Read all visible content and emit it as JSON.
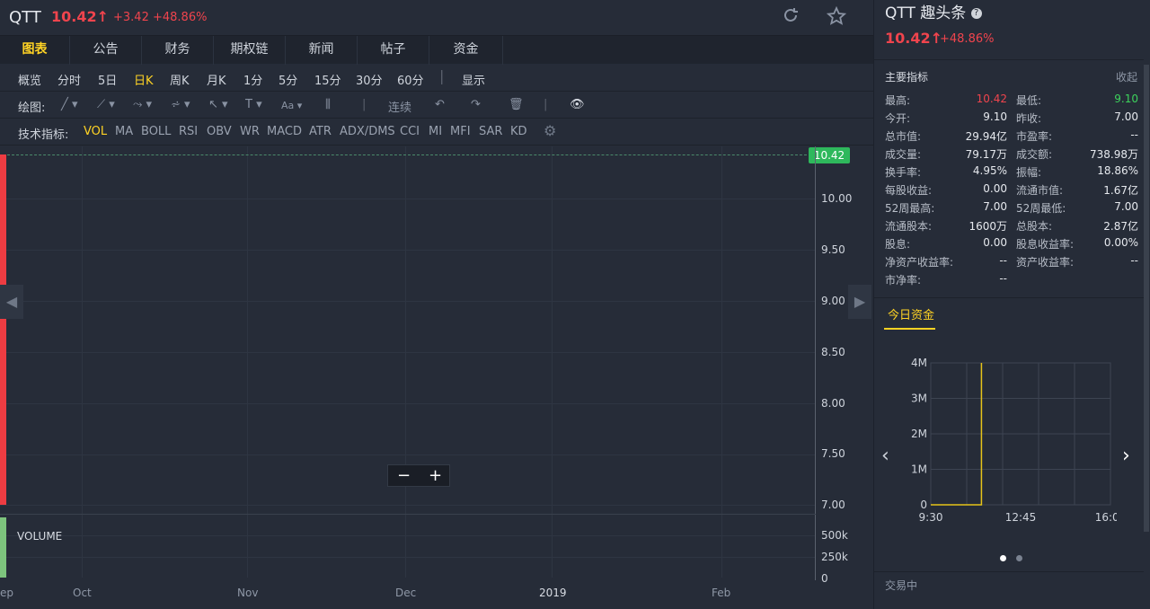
{
  "header": {
    "symbol": "QTT",
    "price": "10.42",
    "arrow": "↑",
    "change": "+3.42",
    "change_pct": "+48.86%",
    "refresh_icon": "refresh-icon",
    "star_icon": "star-icon"
  },
  "tabs": [
    "图表",
    "公告",
    "财务",
    "期权链",
    "新闻",
    "帖子",
    "资金"
  ],
  "periods": [
    "概览",
    "分时",
    "5日",
    "日K",
    "周K",
    "月K",
    "1分",
    "5分",
    "15分",
    "30分",
    "60分",
    "显示"
  ],
  "drawing_label": "绘图:",
  "draw_tools": {
    "continuous": "连续"
  },
  "indicator_label": "技术指标:",
  "indicators": [
    "VOL",
    "MA",
    "BOLL",
    "RSI",
    "OBV",
    "WR",
    "MACD",
    "ATR",
    "ADX/DMS",
    "CCI",
    "MI",
    "MFI",
    "SAR",
    "KD"
  ],
  "chart": {
    "last_price_tag": "10.42",
    "y_ticks": [
      "10.00",
      "9.50",
      "9.00",
      "8.50",
      "8.00",
      "7.50",
      "7.00"
    ],
    "vol_ticks": [
      "500k",
      "250k",
      "0"
    ],
    "x_ticks": [
      "ep",
      "Oct",
      "Nov",
      "Dec",
      "2019",
      "Feb"
    ],
    "volume_label": "VOLUME",
    "zoom_out": "−",
    "zoom_in": "+"
  },
  "panel": {
    "title": "QTT 趣头条",
    "price": "10.42",
    "arrow": "↑",
    "pct": "+48.86%",
    "metrics_title": "主要指标",
    "collapse": "收起",
    "metrics": [
      {
        "l1": "最高:",
        "v1": "10.42",
        "l2": "最低:",
        "v2": "9.10"
      },
      {
        "l1": "今开:",
        "v1": "9.10",
        "l2": "昨收:",
        "v2": "7.00"
      },
      {
        "l1": "总市值:",
        "v1": "29.94亿",
        "l2": "市盈率:",
        "v2": "--"
      },
      {
        "l1": "成交量:",
        "v1": "79.17万",
        "l2": "成交额:",
        "v2": "738.98万"
      },
      {
        "l1": "换手率:",
        "v1": "4.95%",
        "l2": "振幅:",
        "v2": "18.86%"
      },
      {
        "l1": "每股收益:",
        "v1": "0.00",
        "l2": "流通市值:",
        "v2": "1.67亿"
      },
      {
        "l1": "52周最高:",
        "v1": "7.00",
        "l2": "52周最低:",
        "v2": "7.00"
      },
      {
        "l1": "流通股本:",
        "v1": "1600万",
        "l2": "总股本:",
        "v2": "2.87亿"
      },
      {
        "l1": "股息:",
        "v1": "0.00",
        "l2": "股息收益率:",
        "v2": "0.00%"
      },
      {
        "l1": "净资产收益率:",
        "v1": "--",
        "l2": "资产收益率:",
        "v2": "--"
      },
      {
        "l1": "市净率:",
        "v1": "--",
        "l2": "",
        "v2": ""
      }
    ],
    "fund_tab": "今日资金",
    "status": "交易中",
    "colors": {
      "up": "#f0444d",
      "down": "#3dd35c",
      "accent": "#ffd324"
    }
  },
  "chart_data": {
    "type": "line",
    "title": "",
    "xlabel": "",
    "ylabel": "",
    "x": [
      "9:30",
      "11:20",
      "11:20"
    ],
    "values": [
      0,
      0,
      4000000
    ],
    "x_ticks": [
      "9:30",
      "12:45",
      "16:00"
    ],
    "y_ticks": [
      "0",
      "1M",
      "2M",
      "3M",
      "4M"
    ],
    "ylim": [
      0,
      4000000
    ],
    "grid": true
  }
}
